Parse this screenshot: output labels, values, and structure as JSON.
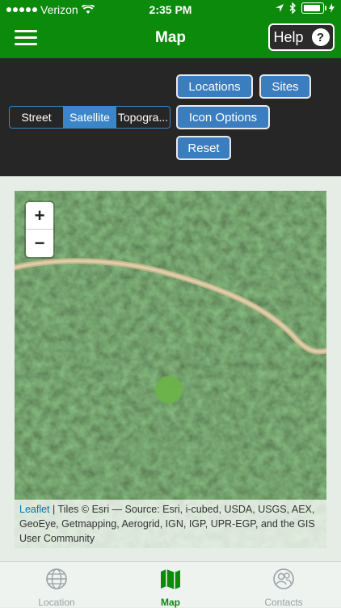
{
  "status_bar": {
    "carrier": "Verizon",
    "time": "2:35 PM"
  },
  "nav": {
    "title": "Map",
    "help_label": "Help",
    "help_icon": "?"
  },
  "layers": {
    "options": [
      "Street",
      "Satellite",
      "Topogra..."
    ],
    "selected": "Satellite"
  },
  "buttons": {
    "locations": "Locations",
    "sites": "Sites",
    "icon_options": "Icon Options",
    "reset": "Reset"
  },
  "map": {
    "zoom_in": "+",
    "zoom_out": "−",
    "attribution_link": "Leaflet",
    "attribution_text": " | Tiles © Esri — Source: Esri, i-cubed, USDA, USGS, AEX, GeoEye, Getmapping, Aerogrid, IGN, IGP, UPR-EGP, and the GIS User Community"
  },
  "tabs": [
    {
      "label": "Location",
      "icon": "globe-icon"
    },
    {
      "label": "Map",
      "icon": "map-icon"
    },
    {
      "label": "Contacts",
      "icon": "contacts-icon"
    }
  ],
  "colors": {
    "header": "#0b8a0b",
    "button": "#3a7ec0",
    "marker": "#6cb34a"
  }
}
